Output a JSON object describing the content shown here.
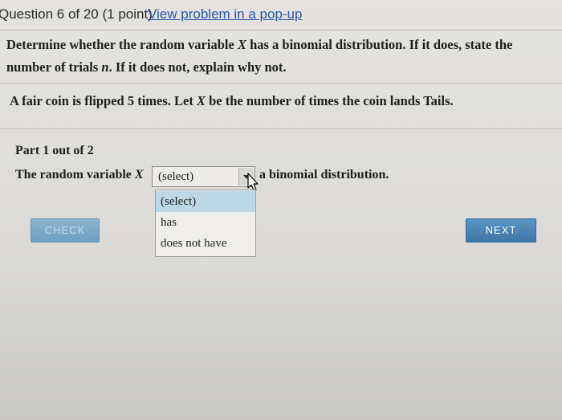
{
  "header": {
    "question_counter": "Question 6 of 20 (1 point)",
    "popup_link": "View problem in a pop-up"
  },
  "prompt": {
    "line1_part1": "Determine whether the random variable ",
    "line1_var": "X",
    "line1_part2": " has a binomial distribution. If it does, state the",
    "line2_part1": "number of trials ",
    "line2_var": "n",
    "line2_part2": ". If it does not, explain why not."
  },
  "scenario": {
    "part1": "A fair coin is flipped 5 times. Let ",
    "var": "X",
    "part2": " be the number of times the coin lands Tails."
  },
  "part": {
    "label": "Part 1 out of 2"
  },
  "question_row": {
    "before": "The random variable ",
    "var": "X",
    "after": "a binomial distribution."
  },
  "select": {
    "value": "(select)",
    "options": [
      "(select)",
      "has",
      "does not have"
    ],
    "highlighted_index": 0
  },
  "buttons": {
    "check": "CHECK",
    "next": "NEXT"
  },
  "colors": {
    "link": "#2956a6",
    "check_button": "#7eabc9",
    "next_button": "#4a85b8",
    "option_highlight": "#bcd8e4"
  }
}
